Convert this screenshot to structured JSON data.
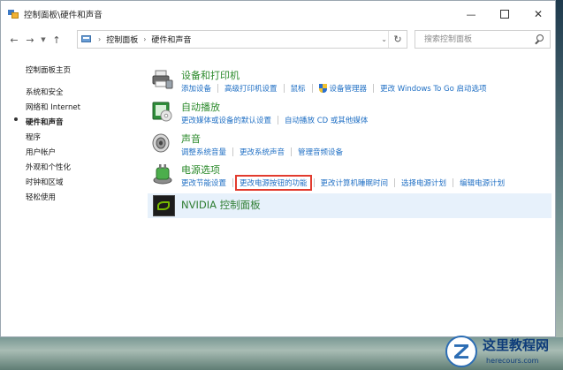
{
  "window": {
    "title": "控制面板\\硬件和声音"
  },
  "address_bar": {
    "breadcrumbs": [
      "控制面板",
      "硬件和声音"
    ]
  },
  "search": {
    "placeholder": "搜索控制面板"
  },
  "sidebar": {
    "items": [
      {
        "label": "控制面板主页",
        "current": false
      },
      {
        "label": "系统和安全",
        "current": false
      },
      {
        "label": "网络和 Internet",
        "current": false
      },
      {
        "label": "硬件和声音",
        "current": true
      },
      {
        "label": "程序",
        "current": false
      },
      {
        "label": "用户帐户",
        "current": false
      },
      {
        "label": "外观和个性化",
        "current": false
      },
      {
        "label": "时钟和区域",
        "current": false
      },
      {
        "label": "轻松使用",
        "current": false
      }
    ]
  },
  "categories": [
    {
      "title": "设备和打印机",
      "icon": "printer-icon",
      "links": [
        "添加设备",
        "高级打印机设置",
        "鼠标",
        "设备管理器",
        "更改 Windows To Go 启动选项"
      ]
    },
    {
      "title": "自动播放",
      "icon": "autoplay-icon",
      "links": [
        "更改媒体或设备的默认设置",
        "自动播放 CD 或其他媒体"
      ]
    },
    {
      "title": "声音",
      "icon": "speaker-icon",
      "links": [
        "调整系统音量",
        "更改系统声音",
        "管理音频设备"
      ]
    },
    {
      "title": "电源选项",
      "icon": "power-icon",
      "links": [
        "更改节能设置",
        "更改电源按钮的功能",
        "更改计算机睡眠时间",
        "选择电源计划",
        "编辑电源计划"
      ]
    },
    {
      "title": "NVIDIA 控制面板",
      "icon": "nvidia-icon",
      "links": []
    }
  ],
  "highlighted_link": "更改电源按钮的功能",
  "colors": {
    "category_title": "#2b8a2b",
    "link": "#1f6fc4",
    "highlight_box": "#e23b2e",
    "hover_row": "#e7f1fb"
  },
  "watermark": {
    "title": "这里教程网",
    "url": "herecours.com"
  }
}
